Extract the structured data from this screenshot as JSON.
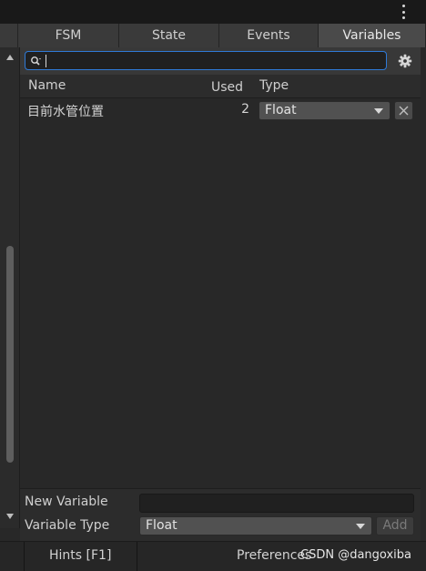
{
  "tabs": [
    {
      "label": "FSM",
      "active": false
    },
    {
      "label": "State",
      "active": false
    },
    {
      "label": "Events",
      "active": false
    },
    {
      "label": "Variables",
      "active": true
    }
  ],
  "search": {
    "value": "",
    "placeholder": ""
  },
  "table": {
    "columns": {
      "name": "Name",
      "used": "Used",
      "type": "Type"
    },
    "rows": [
      {
        "name": "目前水管位置",
        "used": "2",
        "type": "Float"
      }
    ]
  },
  "new_variable": {
    "label": "New Variable",
    "value": "",
    "type_label": "Variable Type",
    "type_value": "Float",
    "add_label": "Add"
  },
  "statusbar": {
    "hints": "Hints [F1]",
    "preferences": "Preferences",
    "watermark": "CSDN @dangoxiba"
  },
  "colors": {
    "accent_focus": "#2f7ad7",
    "background": "#282828",
    "tab_active": "#4a4a4a"
  },
  "icons": [
    "kebab-menu-icon",
    "search-icon",
    "gear-icon",
    "dropdown-arrow-icon",
    "close-icon",
    "scroll-up-icon",
    "scroll-down-icon"
  ]
}
